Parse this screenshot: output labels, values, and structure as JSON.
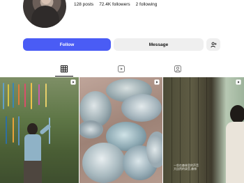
{
  "profile": {
    "stats": {
      "posts": "128 posts",
      "followers": "72.4K followers",
      "following": "2 following"
    }
  },
  "actions": {
    "follow_label": "Follow",
    "message_label": "Message",
    "add_user_icon": "person-add-icon"
  },
  "tabs": [
    {
      "name": "posts",
      "icon": "grid-icon",
      "active": true
    },
    {
      "name": "reels",
      "icon": "reels-icon",
      "active": false
    },
    {
      "name": "tagged",
      "icon": "tagged-icon",
      "active": false
    }
  ],
  "grid": {
    "tiles": [
      {
        "type": "reel",
        "icon": "reel-icon",
        "caption": ""
      },
      {
        "type": "reel",
        "icon": "reel-icon",
        "caption": ""
      },
      {
        "type": "reel",
        "icon": "reel-icon",
        "caption_lines": [
          "一些在森林里的声音",
          "大自然的录音,森林"
        ]
      }
    ]
  },
  "colors": {
    "accent": "#4a5cf5",
    "secondary_button": "#efefef"
  }
}
